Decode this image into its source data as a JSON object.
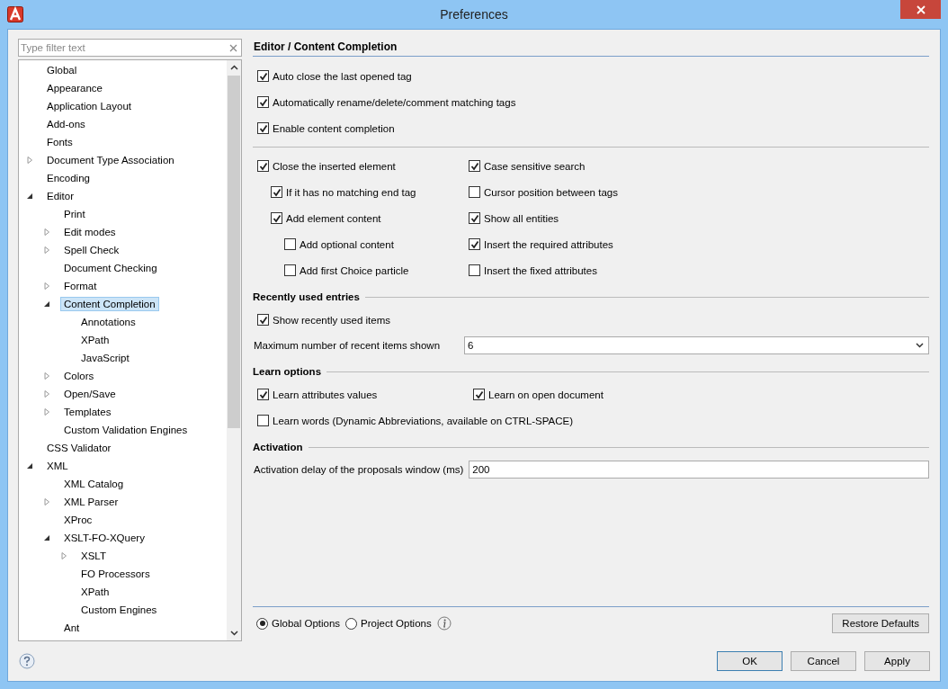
{
  "window": {
    "title": "Preferences"
  },
  "filter": {
    "placeholder": "Type filter text"
  },
  "tree": {
    "items": [
      {
        "label": "Global",
        "selected": false
      },
      {
        "label": "Appearance",
        "selected": false
      },
      {
        "label": "Application Layout",
        "selected": false
      },
      {
        "label": "Add-ons",
        "selected": false
      },
      {
        "label": "Fonts",
        "selected": false
      },
      {
        "label": "Document Type Association",
        "selected": false,
        "expanded": false
      },
      {
        "label": "Encoding",
        "selected": false
      },
      {
        "label": "Editor",
        "selected": false,
        "expanded": true,
        "children": [
          {
            "label": "Print",
            "selected": false
          },
          {
            "label": "Edit modes",
            "selected": false,
            "expanded": false
          },
          {
            "label": "Spell Check",
            "selected": false,
            "expanded": false
          },
          {
            "label": "Document Checking",
            "selected": false
          },
          {
            "label": "Format",
            "selected": false,
            "expanded": false
          },
          {
            "label": "Content Completion",
            "selected": true,
            "expanded": true,
            "children": [
              {
                "label": "Annotations",
                "selected": false
              },
              {
                "label": "XPath",
                "selected": false
              },
              {
                "label": "JavaScript",
                "selected": false
              }
            ]
          },
          {
            "label": "Colors",
            "selected": false,
            "expanded": false
          },
          {
            "label": "Open/Save",
            "selected": false,
            "expanded": false
          },
          {
            "label": "Templates",
            "selected": false,
            "expanded": false
          },
          {
            "label": "Custom Validation Engines",
            "selected": false
          }
        ]
      },
      {
        "label": "CSS Validator",
        "selected": false
      },
      {
        "label": "XML",
        "selected": false,
        "expanded": true,
        "children": [
          {
            "label": "XML Catalog",
            "selected": false
          },
          {
            "label": "XML Parser",
            "selected": false,
            "expanded": false
          },
          {
            "label": "XProc",
            "selected": false
          },
          {
            "label": "XSLT-FO-XQuery",
            "selected": false,
            "expanded": true,
            "children": [
              {
                "label": "XSLT",
                "selected": false,
                "expanded": false
              },
              {
                "label": "FO Processors",
                "selected": false
              },
              {
                "label": "XPath",
                "selected": false
              },
              {
                "label": "Custom Engines",
                "selected": false
              }
            ]
          },
          {
            "label": "Ant",
            "selected": false
          }
        ]
      }
    ]
  },
  "page": {
    "title": "Editor / Content Completion",
    "general_options": [
      {
        "label": "Auto close the last opened tag",
        "checked": true
      },
      {
        "label": "Automatically rename/delete/comment matching tags",
        "checked": true
      },
      {
        "label": "Enable content completion",
        "checked": true
      }
    ],
    "insertion_options": [
      {
        "label": "Close the inserted element",
        "checked": true,
        "children": [
          {
            "label": "If it has no matching end tag",
            "checked": true
          },
          {
            "label": "Add element content",
            "checked": true,
            "children": [
              {
                "label": "Add optional content",
                "checked": false
              },
              {
                "label": "Add first Choice particle",
                "checked": false
              }
            ]
          }
        ]
      }
    ],
    "search_options": [
      {
        "label": "Case sensitive search",
        "checked": true
      },
      {
        "label": "Cursor position between tags",
        "checked": false
      },
      {
        "label": "Show all entities",
        "checked": true
      },
      {
        "label": "Insert the required attributes",
        "checked": true
      },
      {
        "label": "Insert the fixed attributes",
        "checked": false
      }
    ],
    "recent": {
      "title": "Recently used entries",
      "show": {
        "label": "Show recently used items",
        "checked": true
      },
      "max_label": "Maximum number of recent items shown",
      "max_value": "6"
    },
    "learn": {
      "title": "Learn options",
      "options": [
        {
          "label": "Learn attributes values",
          "checked": true
        },
        {
          "label": "Learn on open document",
          "checked": true
        }
      ],
      "words": {
        "label": "Learn words (Dynamic Abbreviations, available on CTRL-SPACE)",
        "checked": false
      }
    },
    "activation": {
      "title": "Activation",
      "delay_label": "Activation delay of the proposals window (ms)",
      "delay_value": "200"
    },
    "scope": [
      {
        "label": "Global Options",
        "selected": true
      },
      {
        "label": "Project Options",
        "selected": false
      }
    ],
    "restore_button": "Restore Defaults"
  },
  "buttons": [
    "OK",
    "Cancel",
    "Apply"
  ]
}
